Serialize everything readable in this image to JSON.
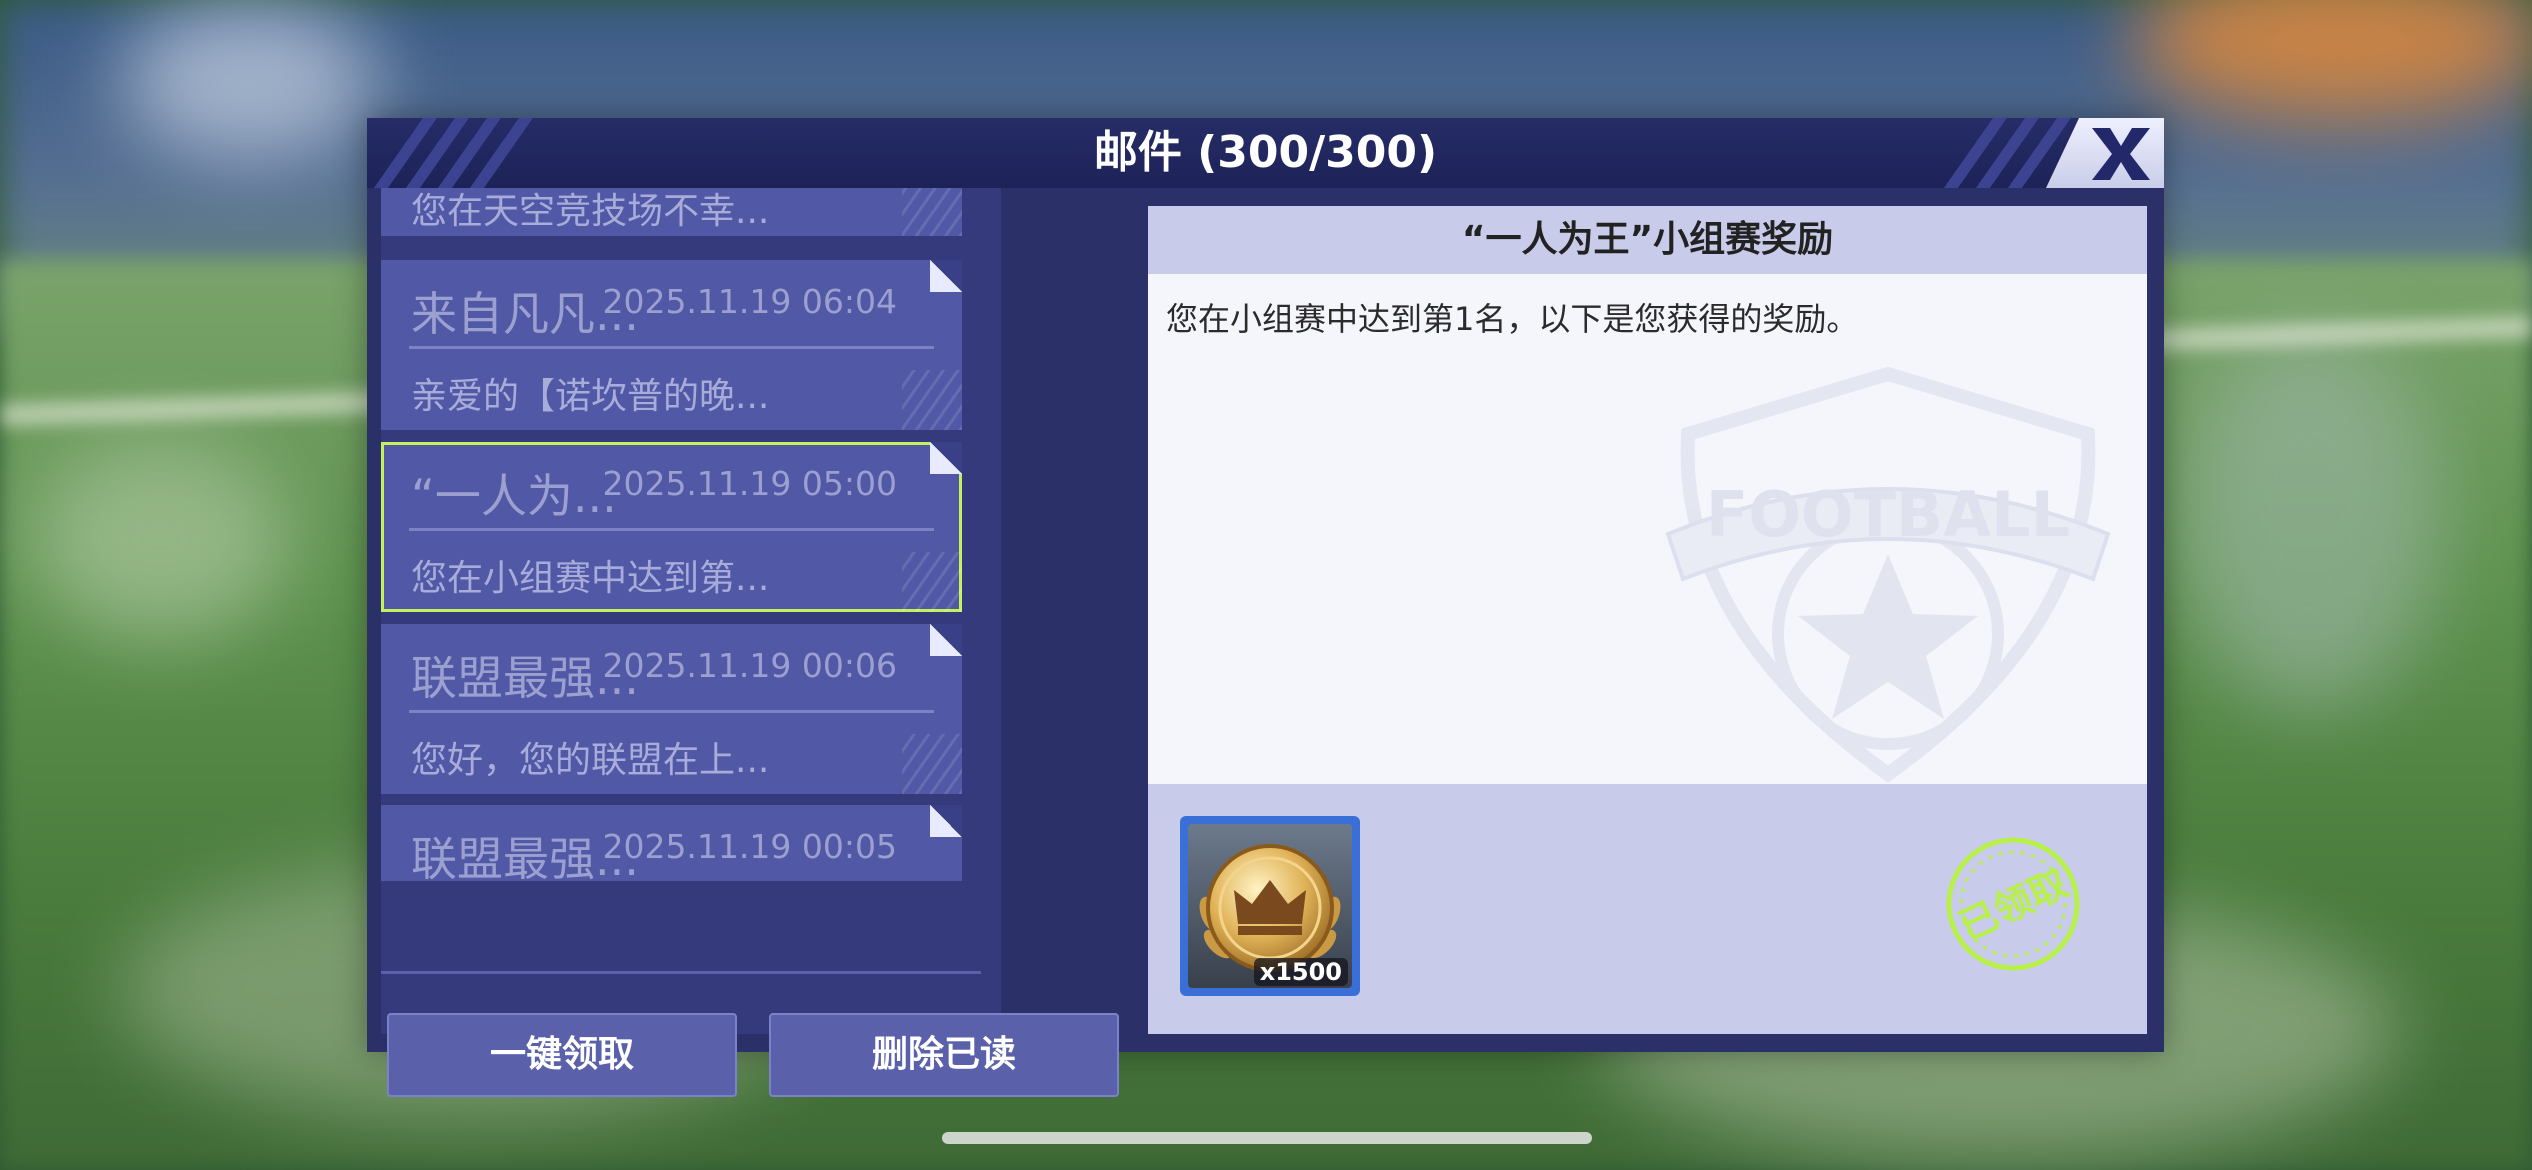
{
  "dialog": {
    "title": "邮件 (300/300)",
    "close_icon": "close-x-icon"
  },
  "mails": [
    {
      "subject": "",
      "date": "",
      "preview": "您在天空竞技场不幸..."
    },
    {
      "subject": "来自凡凡...",
      "date": "2025.11.19 06:04",
      "preview": "亲爱的【诺坎普的晚..."
    },
    {
      "subject": "“一人为...",
      "date": "2025.11.19 05:00",
      "preview": "您在小组赛中达到第...",
      "selected": true
    },
    {
      "subject": "联盟最强...",
      "date": "2025.11.19 00:06",
      "preview": "您好，您的联盟在上..."
    },
    {
      "subject": "联盟最强...",
      "date": "2025.11.19 00:05",
      "preview": ""
    }
  ],
  "actions": {
    "claim_all": "一键领取",
    "delete_read": "删除已读"
  },
  "detail": {
    "title": "“一人为王”小组赛奖励",
    "body": "您在小组赛中达到第1名，以下是您获得的奖励。",
    "watermark_text": "FOOTBALL",
    "reward": {
      "icon": "gold-crown-medal-icon",
      "count": "x1500"
    },
    "stamp": "已领取"
  },
  "colors": {
    "dialog_bg": "#2b3068",
    "mail_item": "#5158a6",
    "selected_outline": "#c4f25c",
    "stamp": "#b8f04a",
    "reward_frame": "#3a6fd8"
  }
}
